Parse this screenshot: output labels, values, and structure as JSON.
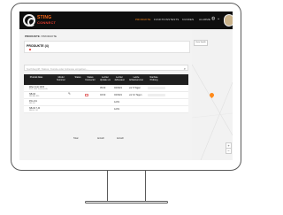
{
  "brand": {
    "name": "STING",
    "subtitle": "CONNECT"
  },
  "nav": {
    "items": [
      "PRODUKTE",
      "FUNKTIONSTESTS",
      "KUNDEN",
      "ALARME"
    ],
    "active_index": 0
  },
  "breadcrumb": {
    "first": "PRODUKTE",
    "separator": "/",
    "second": "PRODUKTE"
  },
  "card": {
    "title": "PRODUKTE (4)"
  },
  "search": {
    "placeholder": "Suchbegriff, Status, Kunde oder Adresse eingeben..."
  },
  "table": {
    "columns": [
      "Produkt Alias",
      "Modul Nummer",
      "Status",
      "Status Connector",
      "Letzter Update um",
      "Letzter Jahrestest",
      "Letzte Artikelnummer",
      "Nächste Prüfung"
    ],
    "rows": [
      {
        "alias": "Wien Unit 1400",
        "sub": "STG 1400 Testkontrolle",
        "last_update": "05/10",
        "last_test": "03/2021",
        "next": "vor 8 Tagen"
      },
      {
        "alias": "NB-90",
        "sub": "NB-SAL-890",
        "last_update": "03/10",
        "last_test": "03/2021",
        "next": "vor 10 Tagen"
      },
      {
        "alias": "FW-131",
        "sub": "NB-131",
        "last_update": "",
        "last_test": "12/01",
        "next": ""
      },
      {
        "alias": "NB-90 7-M",
        "sub": "NB-90 7-M",
        "last_update": "",
        "last_test": "12/01",
        "next": ""
      }
    ],
    "totals": [
      "Total",
      "Anzahl",
      "Anzahl"
    ]
  },
  "map": {
    "control_label": "Karte  Satellit"
  },
  "colors": {
    "accent": "#ff8a1a",
    "header_bg": "#0e0e0e",
    "table_header": "#1f1f1f"
  }
}
